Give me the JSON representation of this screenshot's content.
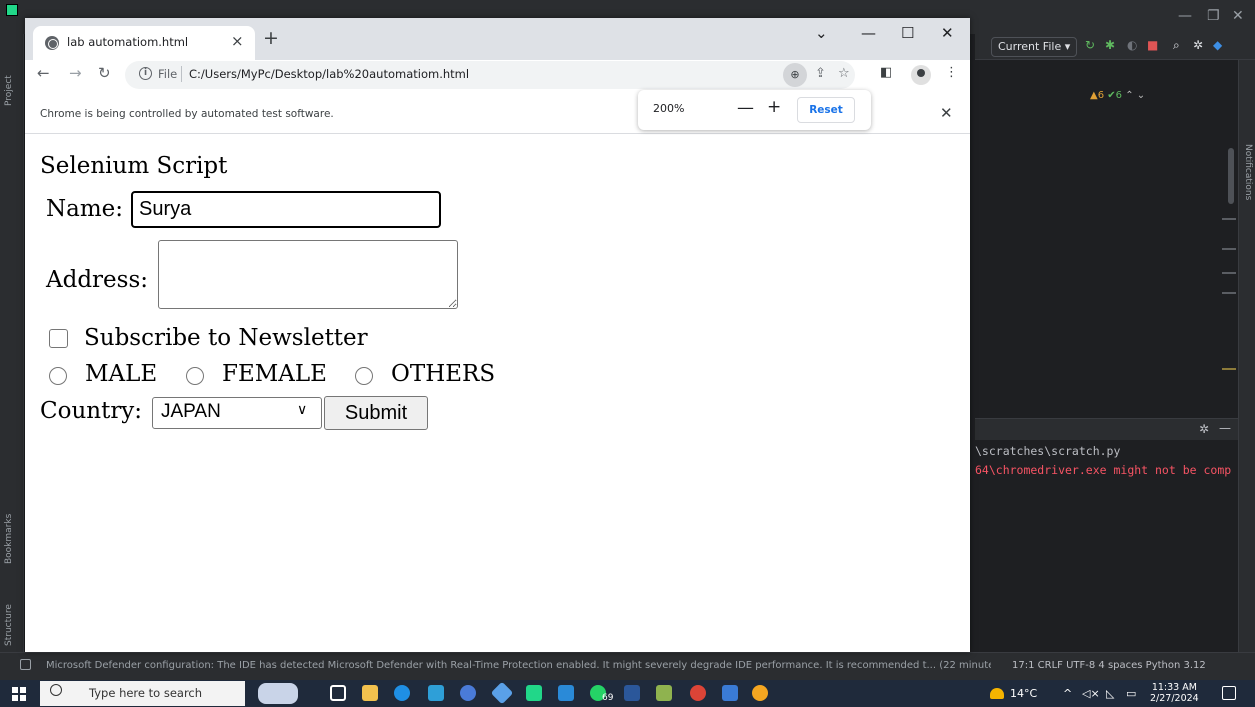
{
  "ide": {
    "run_config": "Current File ▾",
    "inspections_warn": "▲6",
    "inspections_ok": "✔6",
    "project_tab": "Project",
    "bookmarks_tab": "Bookmarks",
    "structure_tab": "Structure",
    "notifications_tab": "Notifications",
    "console_line1": "\\scratches\\scratch.py",
    "console_line2": "64\\chromedriver.exe might not be comp",
    "status_message": "Microsoft Defender configuration: The IDE has detected Microsoft Defender with Real-Time Protection enabled. It might severely degrade IDE performance. It is recommended t... (22 minutes ago)",
    "status_right": "17:1  CRLF  UTF-8  4 spaces  Python 3.12"
  },
  "browser": {
    "tab_title": "lab automatiom.html",
    "url_scheme": "File",
    "url": "C:/Users/MyPc/Desktop/lab%20automatiom.html",
    "infobar_text": "Chrome is being controlled by automated test software.",
    "zoom_popup": {
      "level": "200%",
      "minus": "—",
      "plus": "+",
      "reset_label": "Reset"
    }
  },
  "page": {
    "title": "Selenium Script",
    "name_label": "Name:",
    "name_value": "Surya",
    "address_label": "Address:",
    "newsletter_label": "Subscribe to Newsletter",
    "genders": [
      "MALE",
      "FEMALE",
      "OTHERS"
    ],
    "country_label": "Country:",
    "country_value": "JAPAN",
    "submit_label": "Submit"
  },
  "taskbar": {
    "search_placeholder": "Type here to search",
    "whatsapp_badge": "69",
    "weather": "14°C",
    "time": "11:33 AM",
    "date": "2/27/2024"
  },
  "colors": {
    "ide_bg": "#1e1f22",
    "chrome_tabstrip": "#dee1e6",
    "link_blue": "#1a73e8",
    "taskbar": "#1f2a3b"
  }
}
